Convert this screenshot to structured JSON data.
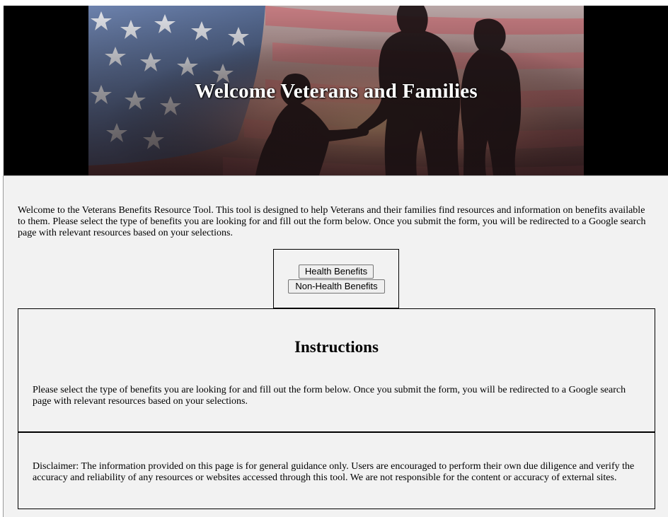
{
  "header": {
    "title": "Welcome Veterans and Families"
  },
  "intro": {
    "text": "Welcome to the Veterans Benefits Resource Tool. This tool is designed to help Veterans and their families find resources and information on benefits available to them. Please select the type of benefits you are looking for and fill out the form below. Once you submit the form, you will be redirected to a Google search page with relevant resources based on your selections."
  },
  "buttons": {
    "health": "Health Benefits",
    "non_health": "Non-Health Benefits"
  },
  "instructions": {
    "heading": "Instructions",
    "text": "Please select the type of benefits you are looking for and fill out the form below. Once you submit the form, you will be redirected to a Google search page with relevant resources based on your selections."
  },
  "disclaimer": {
    "text": "Disclaimer: The information provided on this page is for general guidance only. Users are encouraged to perform their own due diligence and verify the accuracy and reliability of any resources or websites accessed through this tool. We are not responsible for the content or accuracy of external sites."
  },
  "colors": {
    "header_band": "#000000",
    "content_background": "#f2f2f2",
    "flag_blue": "#5a6f9a",
    "flag_red": "#c76a6f"
  }
}
